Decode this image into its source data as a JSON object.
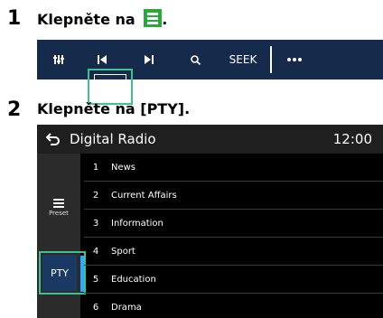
{
  "steps": [
    {
      "number": "1",
      "text": "Klepněte na",
      "suffix": "."
    },
    {
      "number": "2",
      "text": "Klepněte na [PTY]."
    }
  ],
  "toolbar": {
    "buttons": [
      {
        "icon": "equalizer-icon"
      },
      {
        "icon": "previous-track-icon"
      },
      {
        "icon": "next-track-icon"
      },
      {
        "icon": "search-icon"
      },
      {
        "label": "SEEK"
      },
      {
        "icon": "list-icon"
      },
      {
        "icon": "more-icon"
      }
    ]
  },
  "screen": {
    "title": "Digital Radio",
    "clock": "12:00",
    "preset_label": "Preset",
    "pty_label": "PTY",
    "items": [
      {
        "num": "1",
        "label": "News"
      },
      {
        "num": "2",
        "label": "Current Affairs"
      },
      {
        "num": "3",
        "label": "Information"
      },
      {
        "num": "4",
        "label": "Sport"
      },
      {
        "num": "5",
        "label": "Education"
      },
      {
        "num": "6",
        "label": "Drama"
      }
    ]
  },
  "colors": {
    "toolbar_bg": "#162a4c",
    "highlight": "#3ec08f",
    "icon_green": "#2aa83c",
    "pty_bg": "#1b3a63",
    "pty_bar": "#2ea7ff"
  }
}
